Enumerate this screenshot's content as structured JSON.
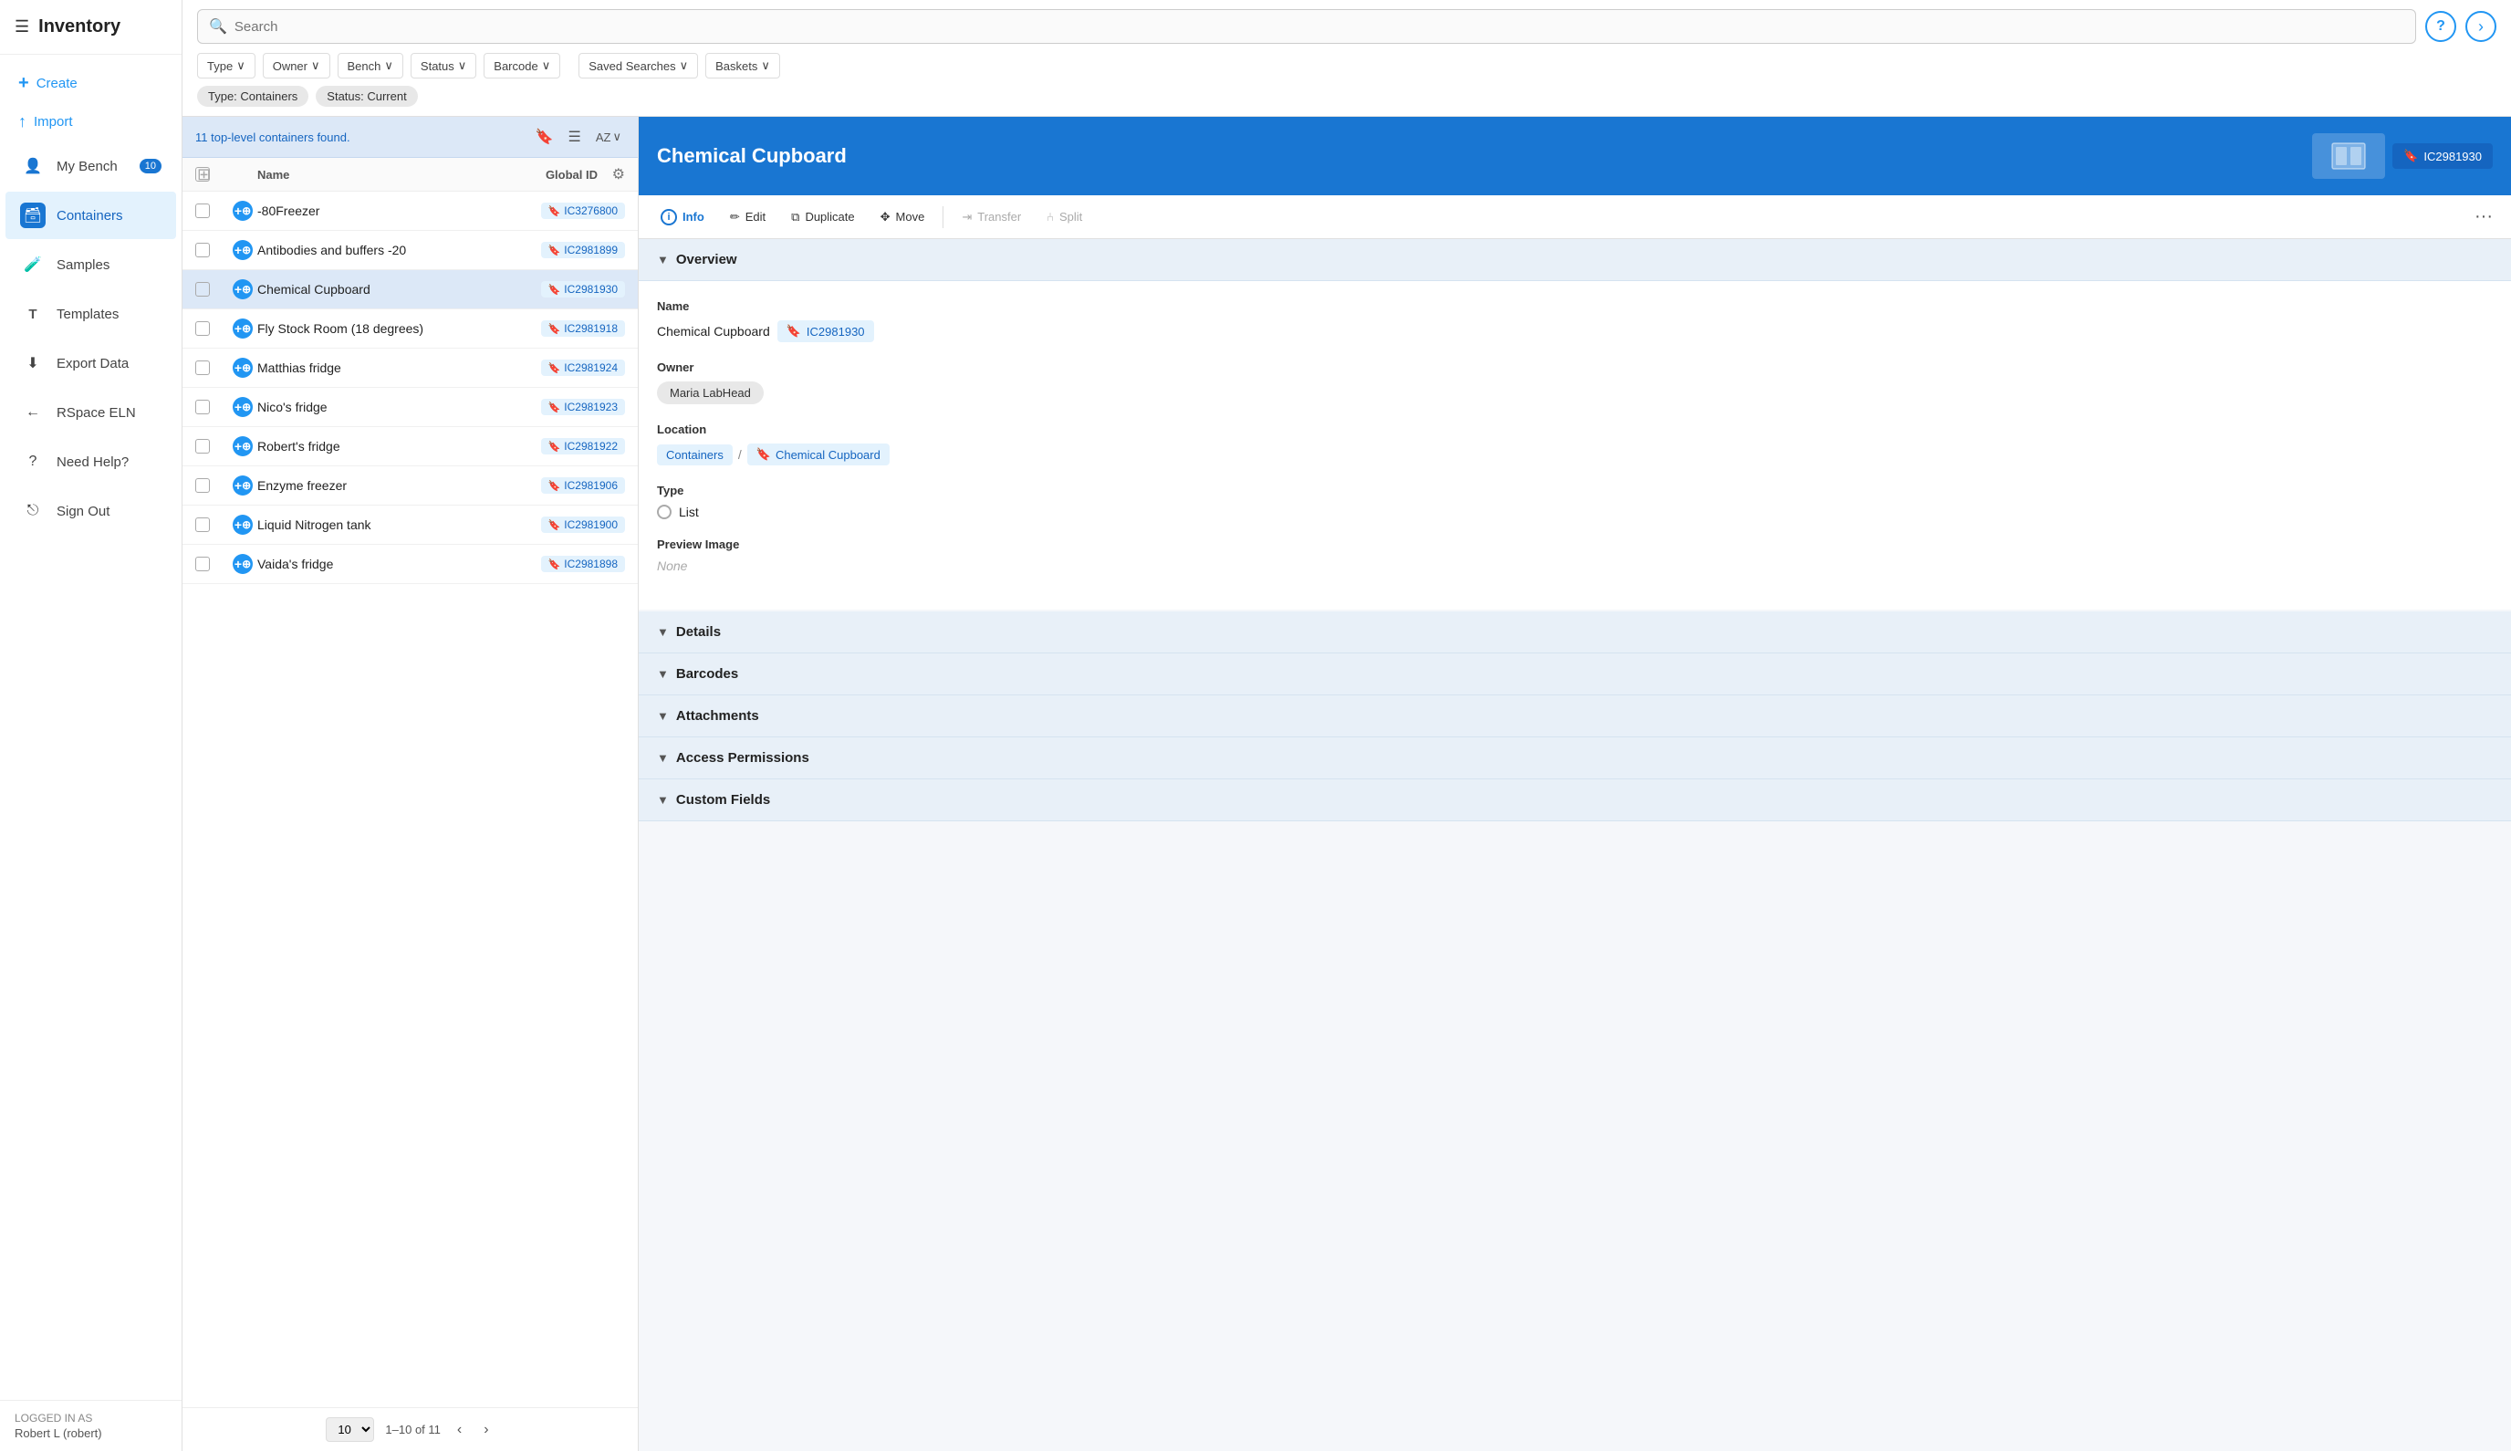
{
  "sidebar": {
    "title": "Inventory",
    "menu_icon": "☰",
    "actions": [
      {
        "id": "create",
        "label": "Create",
        "icon": "+"
      },
      {
        "id": "import",
        "label": "Import",
        "icon": "↑"
      }
    ],
    "items": [
      {
        "id": "my-bench",
        "label": "My Bench",
        "icon": "👤",
        "badge": "10"
      },
      {
        "id": "containers",
        "label": "Containers",
        "icon": "🗃",
        "active": true
      },
      {
        "id": "samples",
        "label": "Samples",
        "icon": "🧪"
      },
      {
        "id": "templates",
        "label": "Templates",
        "icon": "T"
      },
      {
        "id": "export-data",
        "label": "Export Data",
        "icon": "⬇"
      },
      {
        "id": "rspace-eln",
        "label": "RSpace ELN",
        "icon": "←"
      },
      {
        "id": "need-help",
        "label": "Need Help?",
        "icon": "?"
      },
      {
        "id": "sign-out",
        "label": "Sign Out",
        "icon": "⎋"
      }
    ],
    "footer": {
      "logged_in_label": "LOGGED IN AS",
      "user": "Robert L (robert)"
    }
  },
  "search": {
    "placeholder": "Search",
    "filters": [
      {
        "id": "type",
        "label": "Type",
        "has_dropdown": true
      },
      {
        "id": "owner",
        "label": "Owner",
        "has_dropdown": true
      },
      {
        "id": "bench",
        "label": "Bench",
        "has_dropdown": true
      },
      {
        "id": "status",
        "label": "Status",
        "has_dropdown": true
      },
      {
        "id": "barcode",
        "label": "Barcode",
        "has_dropdown": true
      }
    ],
    "secondary_filters": [
      {
        "id": "saved-searches",
        "label": "Saved Searches",
        "has_dropdown": true
      },
      {
        "id": "baskets",
        "label": "Baskets",
        "has_dropdown": true
      }
    ],
    "active_tags": [
      {
        "id": "type-tag",
        "label": "Type: Containers"
      },
      {
        "id": "status-tag",
        "label": "Status: Current"
      }
    ]
  },
  "list": {
    "result_count": "11 top-level containers found.",
    "columns": {
      "name": "Name",
      "global_id": "Global ID"
    },
    "rows": [
      {
        "name": "-80Freezer",
        "id": "IC3276800",
        "selected": false
      },
      {
        "name": "Antibodies and buffers -20",
        "id": "IC2981899",
        "selected": false
      },
      {
        "name": "Chemical Cupboard",
        "id": "IC2981930",
        "selected": true
      },
      {
        "name": "Fly Stock Room (18 degrees)",
        "id": "IC2981918",
        "selected": false
      },
      {
        "name": "Matthias fridge",
        "id": "IC2981924",
        "selected": false
      },
      {
        "name": "Nico's fridge",
        "id": "IC2981923",
        "selected": false
      },
      {
        "name": "Robert's fridge",
        "id": "IC2981922",
        "selected": false
      },
      {
        "name": "Enzyme freezer",
        "id": "IC2981906",
        "selected": false
      },
      {
        "name": "Liquid Nitrogen tank",
        "id": "IC2981900",
        "selected": false
      },
      {
        "name": "Vaida's fridge",
        "id": "IC2981898",
        "selected": false
      }
    ],
    "pagination": {
      "per_page": "10",
      "range": "1–10 of 11"
    }
  },
  "detail": {
    "title": "Chemical Cupboard",
    "id": "IC2981930",
    "actions": {
      "info": "Info",
      "edit": "Edit",
      "duplicate": "Duplicate",
      "move": "Move",
      "transfer": "Transfer",
      "split": "Split"
    },
    "overview": {
      "section_title": "Overview",
      "name_label": "Name",
      "name_value": "Chemical Cupboard",
      "name_id": "IC2981930",
      "owner_label": "Owner",
      "owner_value": "Maria LabHead",
      "location_label": "Location",
      "location_breadcrumb": [
        "Containers",
        "Chemical Cupboard"
      ],
      "type_label": "Type",
      "type_value": "List",
      "preview_label": "Preview Image",
      "preview_value": "None"
    },
    "sections": [
      {
        "id": "details",
        "label": "Details"
      },
      {
        "id": "barcodes",
        "label": "Barcodes"
      },
      {
        "id": "attachments",
        "label": "Attachments"
      },
      {
        "id": "access-permissions",
        "label": "Access Permissions"
      },
      {
        "id": "custom-fields",
        "label": "Custom Fields"
      }
    ]
  }
}
